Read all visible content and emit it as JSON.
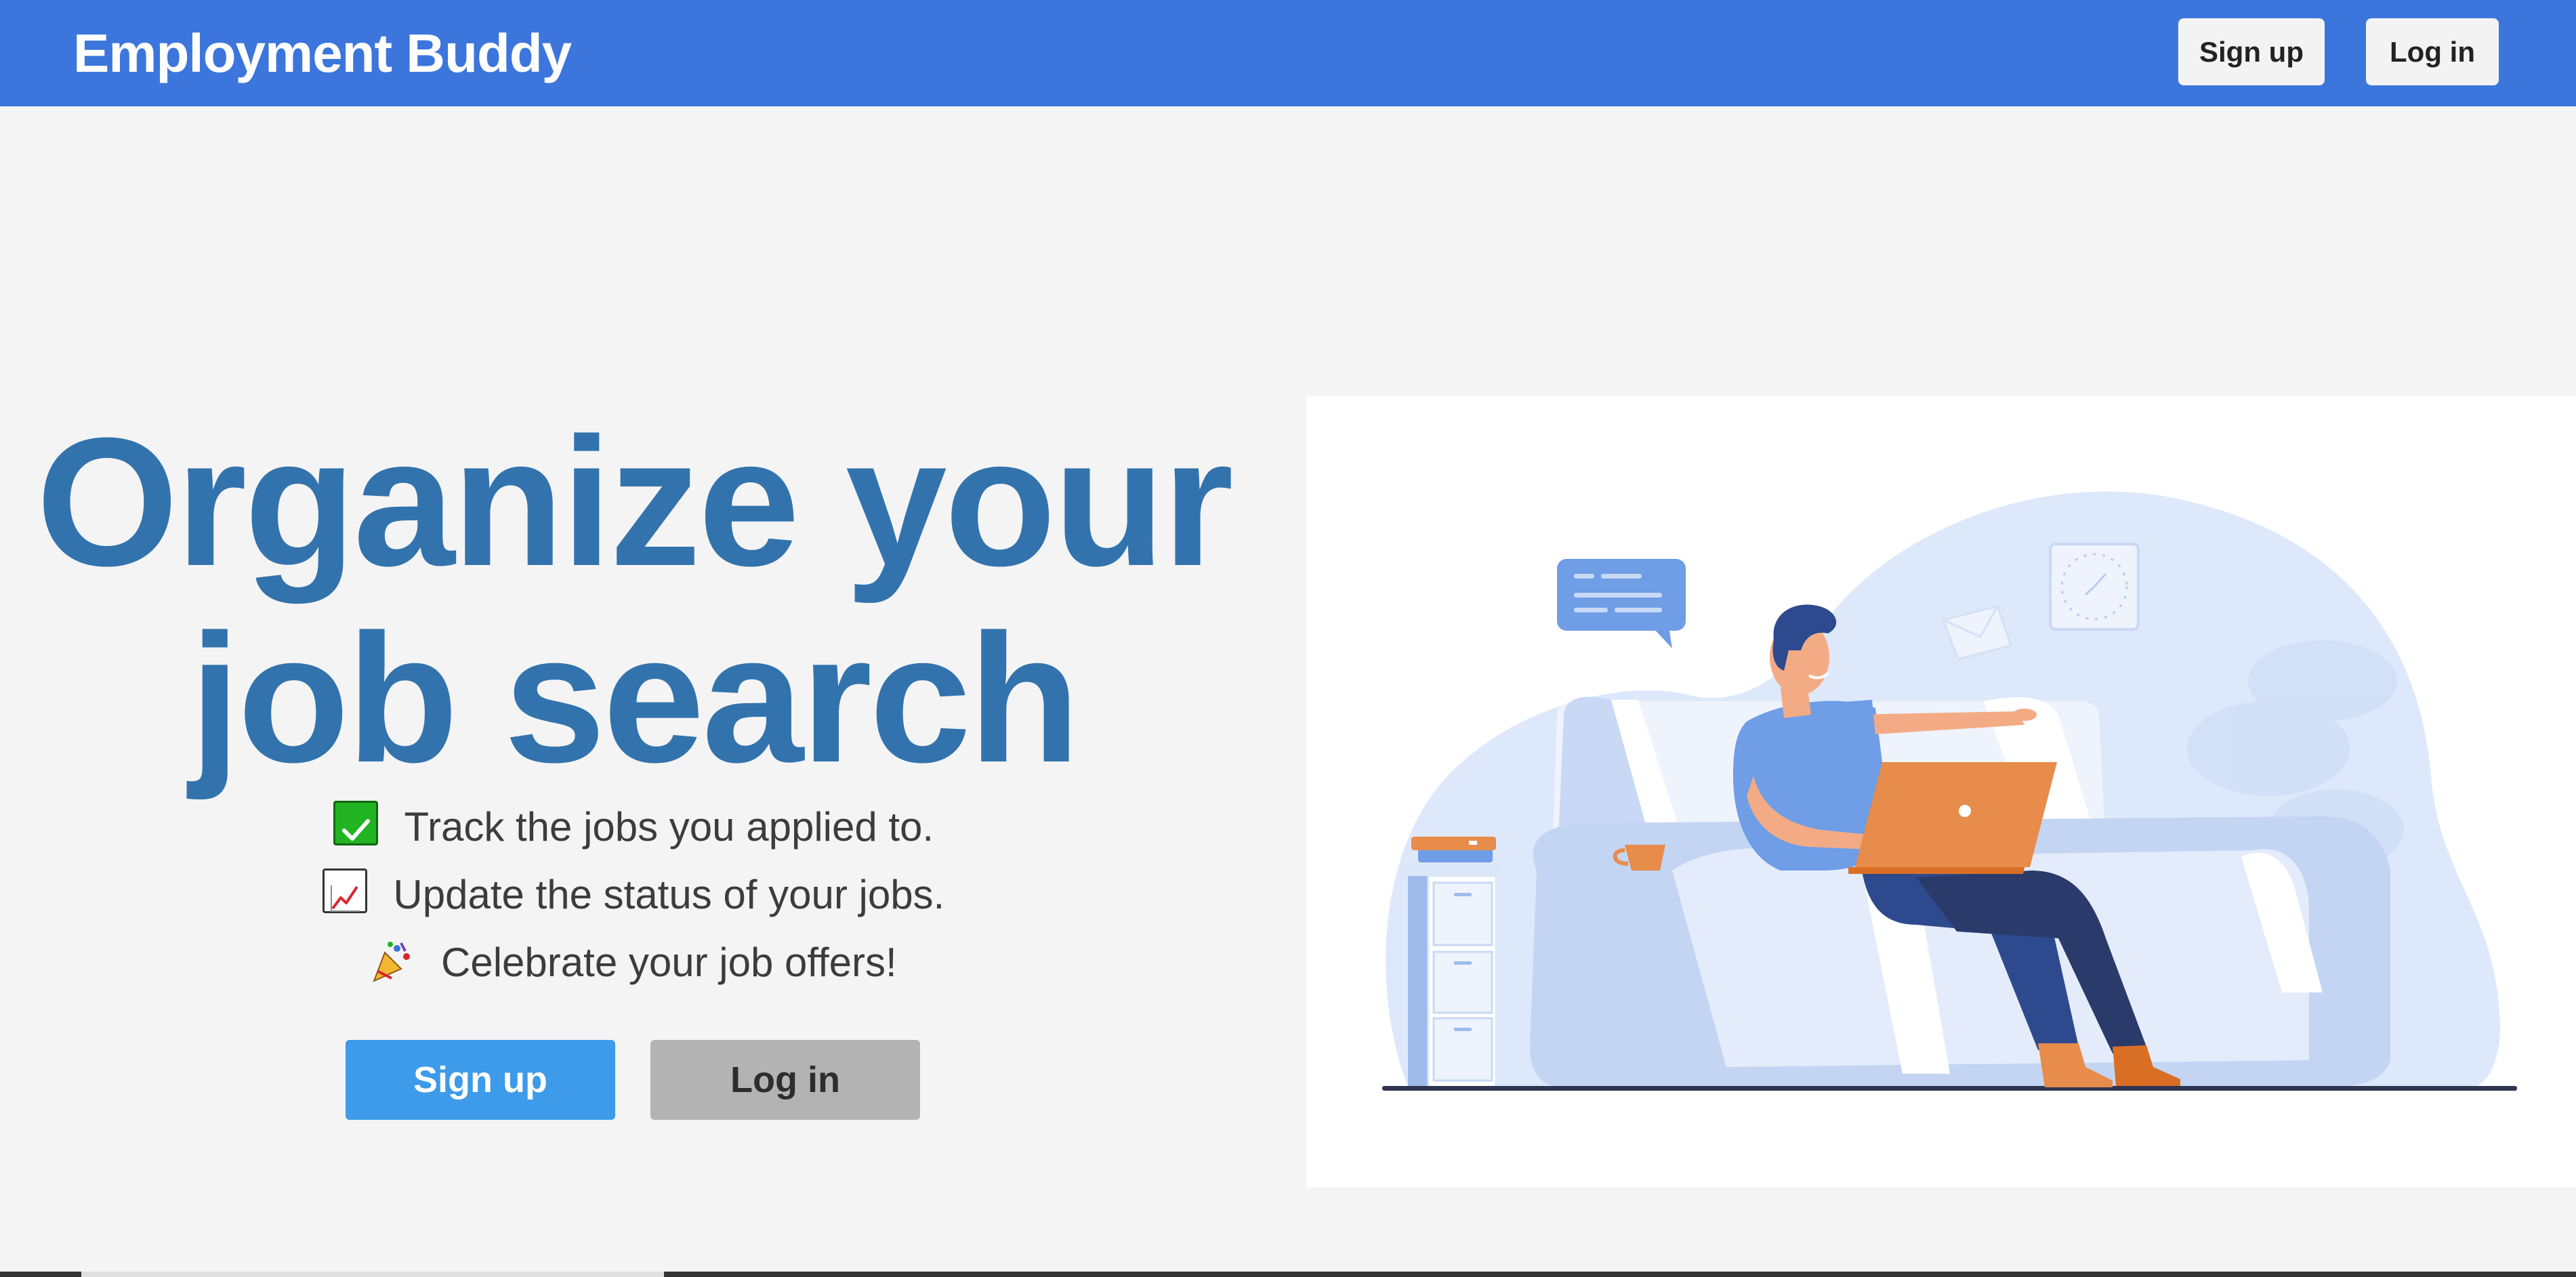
{
  "navbar": {
    "brand": "Employment Buddy",
    "signup_label": "Sign up",
    "login_label": "Log in"
  },
  "hero": {
    "headline_line1": "Organize your",
    "headline_line2": "job search",
    "features": [
      {
        "icon": "check-mark-icon",
        "text": "Track the jobs you applied to."
      },
      {
        "icon": "chart-increasing-icon",
        "text": "Update the status of your jobs."
      },
      {
        "icon": "party-popper-icon",
        "text": "Celebrate your job offers!"
      }
    ],
    "signup_label": "Sign up",
    "login_label": "Log in"
  },
  "colors": {
    "navbar": "#3c76dc",
    "headline": "#3373ad",
    "signup_button": "#3d9be9",
    "login_button": "#b3b3b3",
    "background": "#f4f4f4"
  }
}
